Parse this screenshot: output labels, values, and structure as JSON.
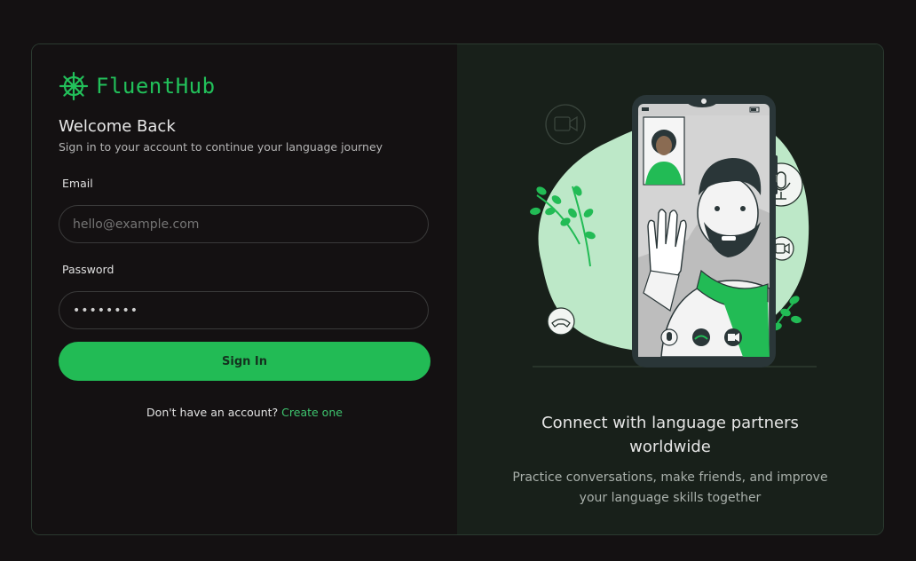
{
  "brand": {
    "name": "FluentHub",
    "accent": "#22c05a"
  },
  "login": {
    "title": "Welcome Back",
    "subtitle": "Sign in to your account to continue your language journey",
    "email_label": "Email",
    "email_placeholder": "hello@example.com",
    "password_label": "Password",
    "password_value": "••••••••",
    "signin_label": "Sign In",
    "signup_prompt": "Don't have an account?",
    "signup_link": "Create one"
  },
  "promo": {
    "title": "Connect with language partners worldwide",
    "description": "Practice conversations, make friends, and improve your language skills together",
    "illustration_icons": [
      "video-camera-icon",
      "microphone-icon",
      "phone-hangup-icon",
      "video-call-icon"
    ]
  },
  "colors": {
    "button": "#22bb55",
    "link": "#3ec46e",
    "panel_dark": "#141112",
    "panel_green": "#18201a"
  }
}
